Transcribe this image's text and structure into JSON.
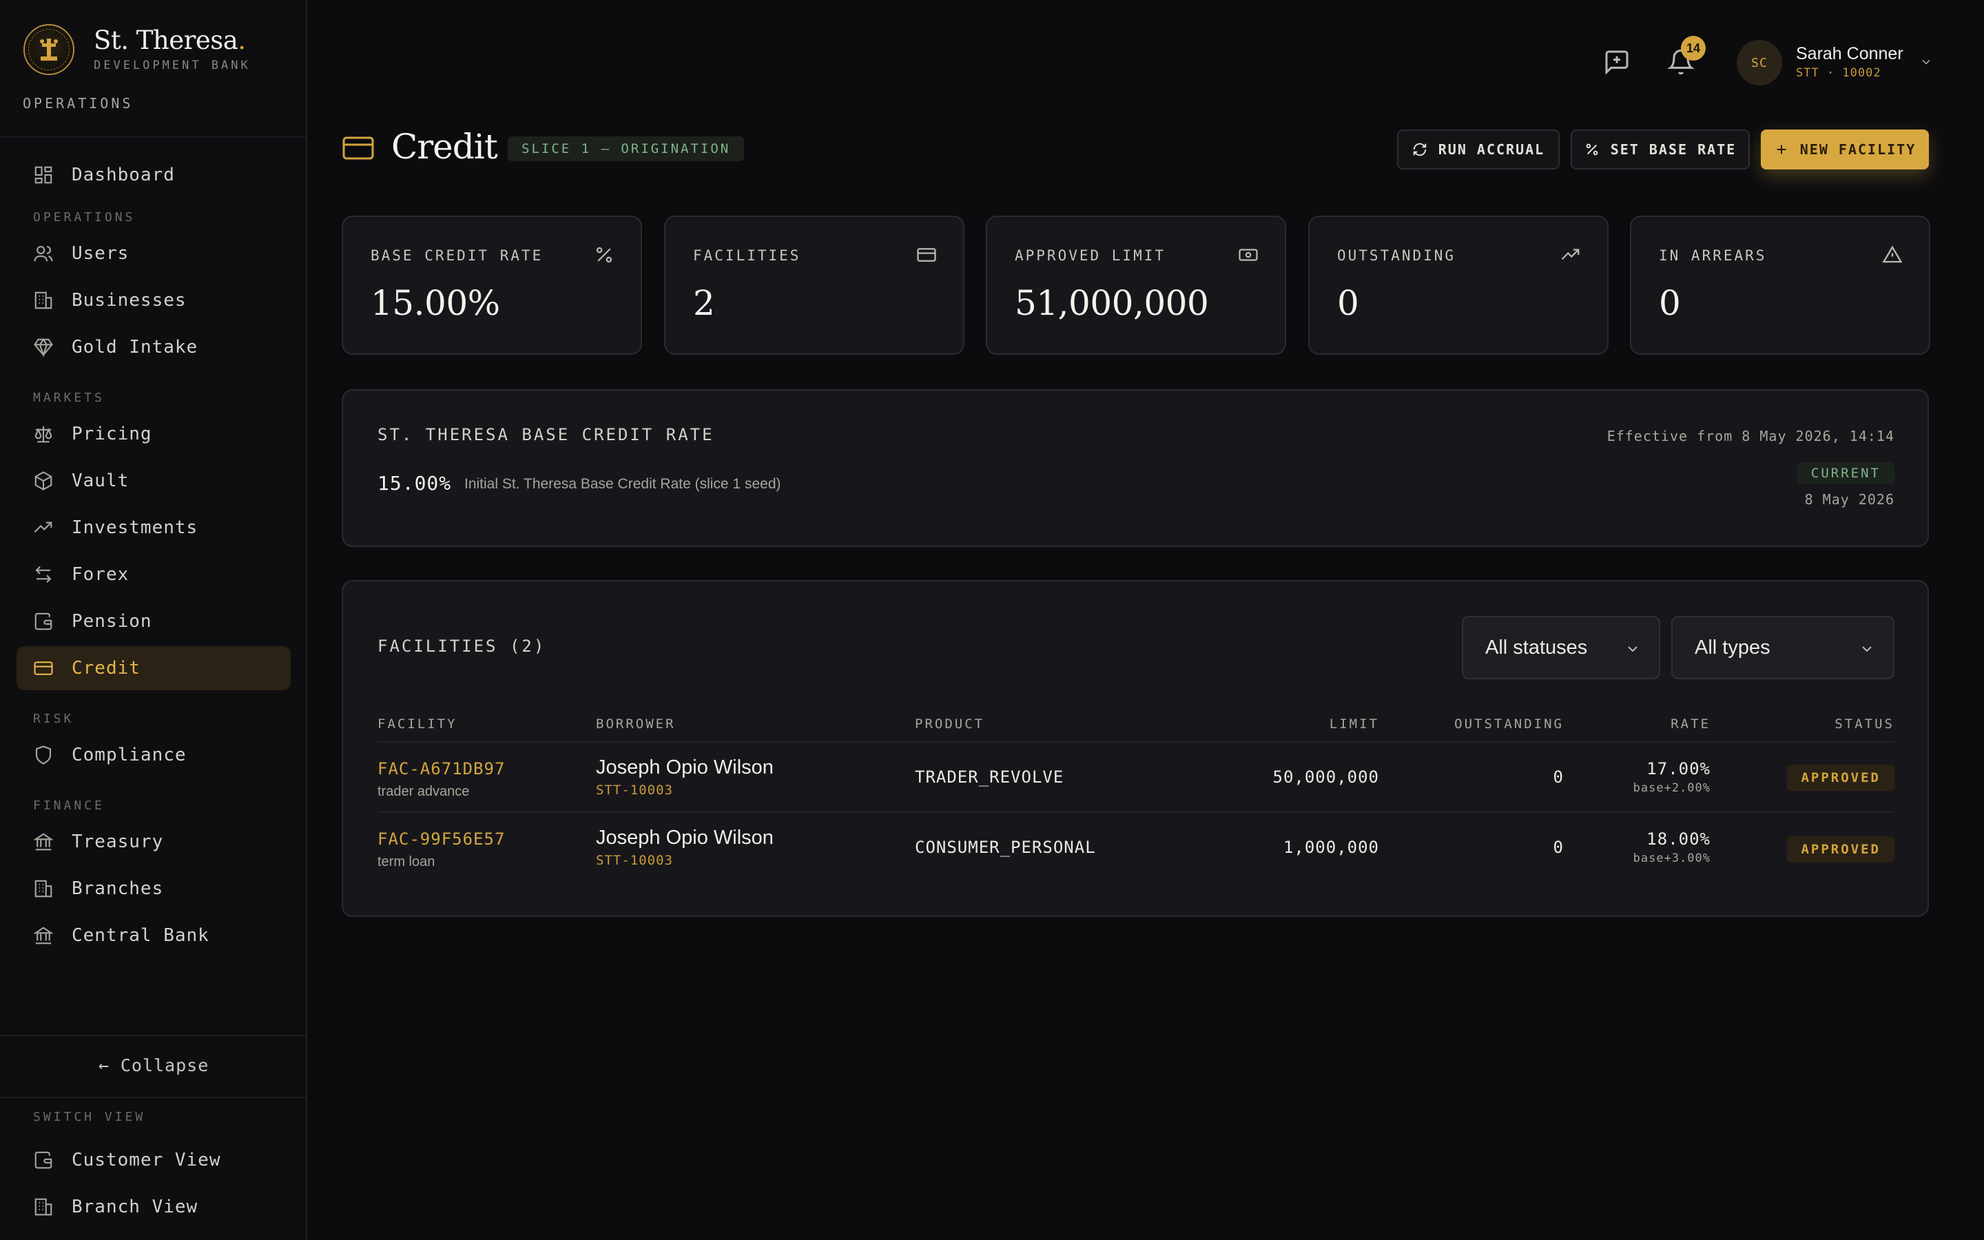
{
  "brand": {
    "name": "St. Theresa",
    "name_dot": ".",
    "subtitle": "DEVELOPMENT BANK",
    "section": "OPERATIONS"
  },
  "sidebar": {
    "items": [
      {
        "label": "Dashboard",
        "icon": "dashboard-icon"
      },
      {
        "section": "OPERATIONS"
      },
      {
        "label": "Users",
        "icon": "users-icon"
      },
      {
        "label": "Businesses",
        "icon": "building-icon"
      },
      {
        "label": "Gold Intake",
        "icon": "gem-icon"
      },
      {
        "section": "MARKETS"
      },
      {
        "label": "Pricing",
        "icon": "scale-icon"
      },
      {
        "label": "Vault",
        "icon": "box-icon"
      },
      {
        "label": "Investments",
        "icon": "trending-icon"
      },
      {
        "label": "Forex",
        "icon": "arrows-icon"
      },
      {
        "label": "Pension",
        "icon": "wallet-icon"
      },
      {
        "label": "Credit",
        "icon": "credit-card-icon",
        "active": true
      },
      {
        "section": "RISK"
      },
      {
        "label": "Compliance",
        "icon": "shield-icon"
      },
      {
        "section": "FINANCE"
      },
      {
        "label": "Treasury",
        "icon": "bank-icon"
      },
      {
        "label": "Branches",
        "icon": "building-icon"
      },
      {
        "label": "Central Bank",
        "icon": "bank-icon"
      }
    ],
    "collapse_label": "← Collapse",
    "switch_view": {
      "section": "SWITCH VIEW",
      "items": [
        {
          "label": "Customer View",
          "icon": "wallet-icon"
        },
        {
          "label": "Branch View",
          "icon": "building-icon"
        }
      ]
    }
  },
  "topbar": {
    "notification_count": "14",
    "user": {
      "initials": "SC",
      "name": "Sarah Conner",
      "sub": "STT · 10002"
    }
  },
  "header": {
    "title": "Credit",
    "badge": "SLICE 1 — ORIGINATION",
    "buttons": {
      "run_accrual": "RUN ACCRUAL",
      "set_base_rate": "SET BASE RATE",
      "new_facility": "NEW FACILITY"
    }
  },
  "stats": [
    {
      "label": "BASE CREDIT RATE",
      "value": "15.00%",
      "icon": "percent-icon"
    },
    {
      "label": "FACILITIES",
      "value": "2",
      "icon": "credit-card-icon"
    },
    {
      "label": "APPROVED LIMIT",
      "value": "51,000,000",
      "icon": "banknote-icon"
    },
    {
      "label": "OUTSTANDING",
      "value": "0",
      "icon": "trending-up-icon"
    },
    {
      "label": "IN ARREARS",
      "value": "0",
      "icon": "alert-triangle-icon"
    }
  ],
  "base_rate": {
    "title": "ST. THERESA BASE CREDIT RATE",
    "effective": "Effective from 8 May 2026, 14:14",
    "rate": "15.00%",
    "description": "Initial St. Theresa Base Credit Rate (slice 1 seed)",
    "status": "CURRENT",
    "date": "8 May 2026"
  },
  "facilities": {
    "title": "FACILITIES (2)",
    "filters": {
      "status": "All statuses",
      "type": "All types"
    },
    "columns": [
      "FACILITY",
      "BORROWER",
      "PRODUCT",
      "LIMIT",
      "OUTSTANDING",
      "RATE",
      "STATUS"
    ],
    "rows": [
      {
        "id": "FAC-A671DB97",
        "type": "trader advance",
        "borrower": "Joseph Opio Wilson",
        "borrower_id": "STT-10003",
        "product": "TRADER_REVOLVE",
        "limit": "50,000,000",
        "outstanding": "0",
        "rate": "17.00%",
        "rate_sub": "base+2.00%",
        "status": "APPROVED"
      },
      {
        "id": "FAC-99F56E57",
        "type": "term loan",
        "borrower": "Joseph Opio Wilson",
        "borrower_id": "STT-10003",
        "product": "CONSUMER_PERSONAL",
        "limit": "1,000,000",
        "outstanding": "0",
        "rate": "18.00%",
        "rate_sub": "base+3.00%",
        "status": "APPROVED"
      }
    ]
  },
  "colors": {
    "accent": "#d4a53c",
    "background": "#0c0c0f",
    "card": "#17171b",
    "success": "#7fb58c"
  }
}
